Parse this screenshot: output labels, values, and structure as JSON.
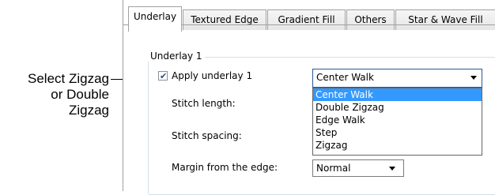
{
  "callout": {
    "line1": "Select Zigzag",
    "line2": "or Double",
    "line3": "Zigzag"
  },
  "tabs": [
    "Underlay",
    "Textured Edge",
    "Gradient Fill",
    "Others",
    "Star & Wave Fill"
  ],
  "group": {
    "title": "Underlay 1",
    "apply_label": "Apply underlay 1",
    "apply_checked": true,
    "stitch_length_label": "Stitch length:",
    "stitch_spacing_label": "Stitch spacing:",
    "margin_label": "Margin from the edge:"
  },
  "type_combo": {
    "value": "Center Walk",
    "options": [
      "Center Walk",
      "Double Zigzag",
      "Edge Walk",
      "Step",
      "Zigzag"
    ]
  },
  "margin_combo": {
    "value": "Normal"
  },
  "colors": {
    "selection": "#3399ff",
    "border": "#a0a0a0"
  }
}
